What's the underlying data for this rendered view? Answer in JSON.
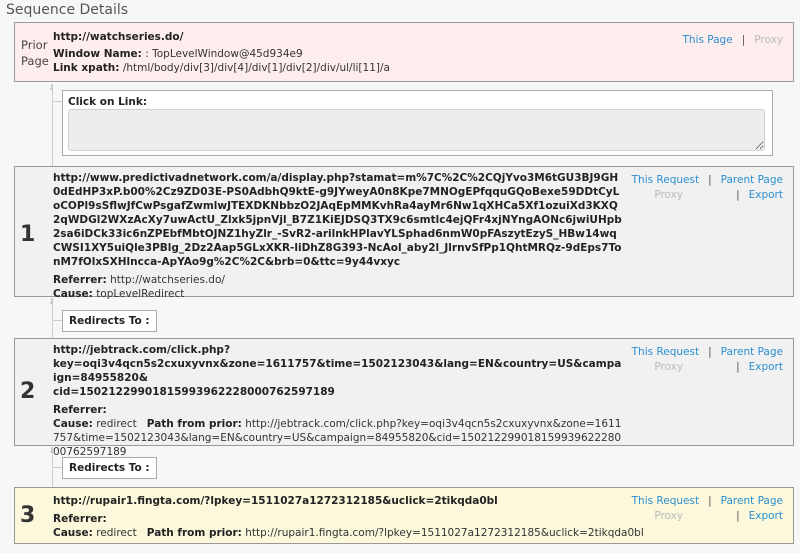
{
  "page_title": "Sequence Details",
  "prior": {
    "label": "Prior Page",
    "url": "http://watchseries.do/",
    "window_name_label": "Window Name:",
    "window_name_value": ": TopLevelWindow@45d934e9",
    "xpath_label": "Link xpath:",
    "xpath_value": "/html/body/div[3]/div[4]/div[1]/div[2]/div/ul/li[11]/a",
    "links": {
      "this_page": "This Page",
      "sep": "|",
      "proxy": "Proxy"
    }
  },
  "click_action": {
    "label": "Click on Link:",
    "value": ""
  },
  "redirect_label": "Redirects To :",
  "requests": [
    {
      "number": "1",
      "url": "http://www.predictivadnetwork.com/a/display.php?stamat=m%7C%2C%2CQjYvo3M6tGU3BJ9GH0dEdHP3xP.b00%2Cz9ZD03E-PS0AdbhQ9ktE-g9JYweyA0n8Kpe7MNOgEPfqquGQoBexe59DDtCyLoCOPl9sSflwJfCwPsgafZwmlwJTEXDKNbbzO2JAqEpMMKvhRa4ayMr6Nw1qXHCa5Xf1ozuiXd3KXQ2qWDGl2WXzAcXy7uwActU_Zlxk5jpnVjl_B7Z1KiEJDSQ3TX9c6smtlc4ejQFr4xjNYngAONc6jwiUHpb2sa6iDCk33ic6nZPEbfMbtOJNZ1hyZlr_-SvR2-arilnkHPlavYLSphad6nmW0pFAszytEzyS_HBw14wqCWSI1XY5uiQle3PBlg_2Dz2Aap5GLxXKR-liDhZ8G393-NcAol_aby2l_JlrnvSfPp1QhtMRQz-9dEps7TonM7fOlxSXHlncca-ApYAo9g%2C%2C&brb=0&ttc=9y44vxyc",
      "referrer_label": "Referrer:",
      "referrer": "http://watchseries.do/",
      "cause_label": "Cause:",
      "cause": "topLevelRedirect",
      "path_label": "",
      "path": "",
      "links": {
        "this_request": "This Request",
        "parent_page": "Parent Page",
        "proxy": "Proxy",
        "export": "Export",
        "sep": "|"
      }
    },
    {
      "number": "2",
      "url": "http://jebtrack.com/click.php?key=oqi3v4qcn5s2cxuxyvnx&zone=1611757&time=1502123043&lang=EN&country=US&campaign=84955820&cid=150212299018159939622280007625971 89",
      "referrer_label": "Referrer:",
      "referrer": "",
      "cause_label": "Cause:",
      "cause": "redirect",
      "path_label": "Path from prior:",
      "path": "http://jebtrack.com/click.php?key=oqi3v4qcn5s2cxuxyvnx&zone=1611757&time=1502123043&lang=EN&country=US&campaign=84955820&cid=15021229901815993962228000762597189",
      "links": {
        "this_request": "This Request",
        "parent_page": "Parent Page",
        "proxy": "Proxy",
        "export": "Export",
        "sep": "|"
      }
    },
    {
      "number": "3",
      "url": "http://rupair1.fingta.com/?lpkey=1511027a1272312185&uclick=2tikqda0bl",
      "referrer_label": "Referrer:",
      "referrer": "",
      "cause_label": "Cause:",
      "cause": "redirect",
      "path_label": "Path from prior:",
      "path": "http://rupair1.fingta.com/?lpkey=1511027a1272312185&uclick=2tikqda0bl",
      "links": {
        "this_request": "This Request",
        "parent_page": "Parent Page",
        "proxy": "Proxy",
        "export": "Export",
        "sep": "|"
      }
    }
  ]
}
